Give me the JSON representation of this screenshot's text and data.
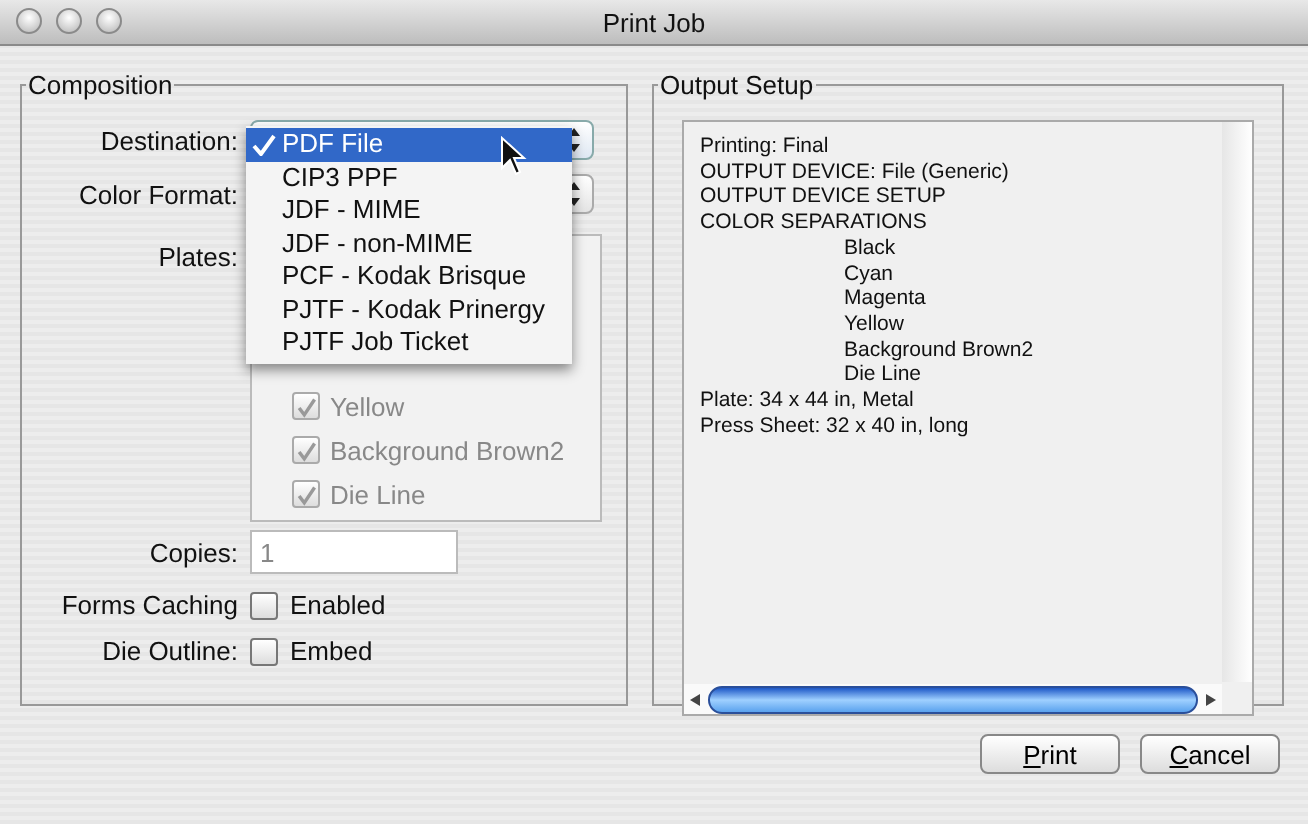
{
  "window": {
    "title": "Print Job"
  },
  "composition": {
    "title": "Composition",
    "destination": {
      "label": "Destination:"
    },
    "color_format": {
      "label": "Color Format:"
    },
    "plates": {
      "label": "Plates:",
      "disabled": true,
      "items": [
        {
          "label": "Yellow",
          "checked": true
        },
        {
          "label": "Background Brown2",
          "checked": true
        },
        {
          "label": "Die Line",
          "checked": true
        }
      ]
    },
    "copies": {
      "label": "Copies:",
      "value": "1",
      "disabled": true
    },
    "forms_caching": {
      "label": "Forms Caching",
      "option": "Enabled",
      "checked": false
    },
    "die_outline": {
      "label": "Die Outline:",
      "option": "Embed",
      "checked": false
    }
  },
  "destination_menu": {
    "items": [
      {
        "label": "PDF File",
        "selected": true
      },
      {
        "label": "CIP3 PPF",
        "selected": false
      },
      {
        "label": "JDF - MIME",
        "selected": false
      },
      {
        "label": "JDF - non-MIME",
        "selected": false
      },
      {
        "label": "PCF - Kodak Brisque",
        "selected": false
      },
      {
        "label": "PJTF - Kodak Prinergy",
        "selected": false
      },
      {
        "label": "PJTF Job Ticket",
        "selected": false
      }
    ]
  },
  "output_setup": {
    "title": "Output Setup",
    "lines": [
      {
        "text": "Printing: Final",
        "kind": "line"
      },
      {
        "text": "OUTPUT DEVICE: File (Generic)",
        "kind": "line"
      },
      {
        "text": "OUTPUT DEVICE SETUP",
        "kind": "line"
      },
      {
        "text": "COLOR SEPARATIONS",
        "kind": "line"
      },
      {
        "text": "Black",
        "kind": "item"
      },
      {
        "text": "Cyan",
        "kind": "item"
      },
      {
        "text": "Magenta",
        "kind": "item"
      },
      {
        "text": "Yellow",
        "kind": "item"
      },
      {
        "text": "Background Brown2",
        "kind": "item"
      },
      {
        "text": "Die Line",
        "kind": "item"
      },
      {
        "text": "Plate: 34 x 44 in, Metal",
        "kind": "line"
      },
      {
        "text": "Press Sheet: 32 x 40 in, long",
        "kind": "line"
      }
    ]
  },
  "buttons": [
    {
      "label": "Print",
      "underline_first": true
    },
    {
      "label": "Cancel",
      "underline_first": true
    }
  ]
}
